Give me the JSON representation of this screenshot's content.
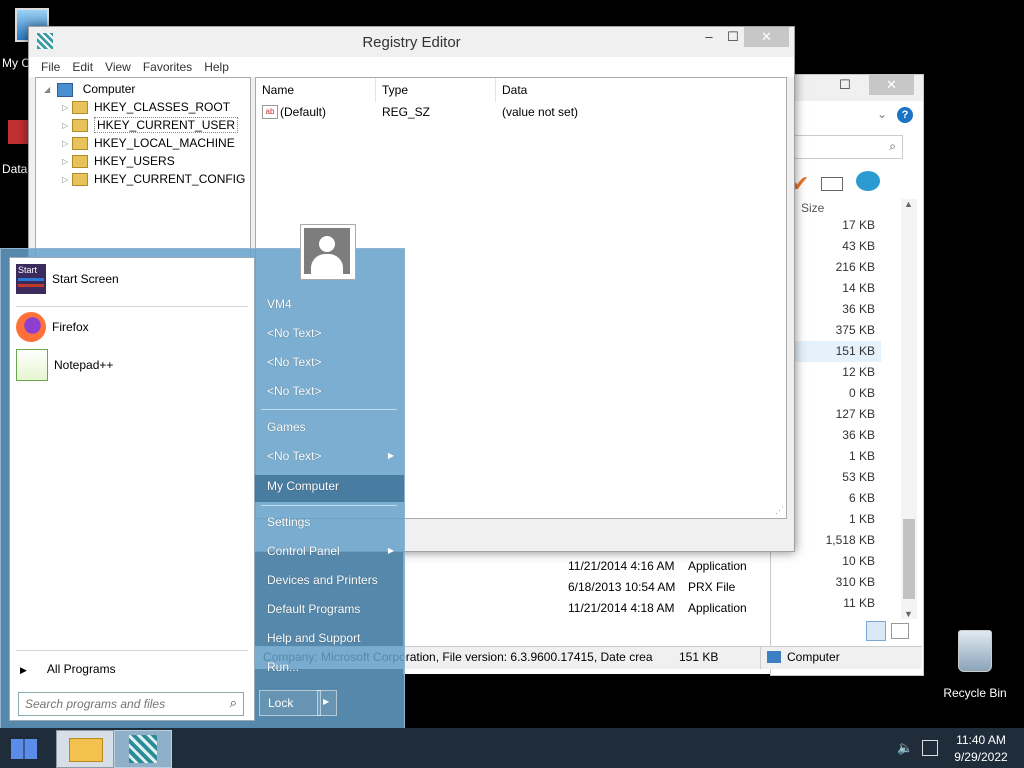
{
  "desktop": {
    "icons": [
      {
        "label": "My C",
        "icon": "computer-icon"
      },
      {
        "label": "Data",
        "icon": "shortcut-icon"
      },
      {
        "label": "Recycle Bin",
        "icon": "recycle-bin-icon"
      }
    ]
  },
  "explorer": {
    "min": "–",
    "max": "☐",
    "close": "✕",
    "size_header": "Size",
    "sizes": [
      "17 KB",
      "43 KB",
      "216 KB",
      "14 KB",
      "36 KB",
      "375 KB",
      "151 KB",
      "12 KB",
      "0 KB",
      "127 KB",
      "36 KB",
      "1 KB",
      "53 KB",
      "6 KB",
      "1 KB",
      "1,518 KB",
      "10 KB",
      "310 KB",
      "11 KB"
    ],
    "rows": [
      {
        "date": "11/21/2014 4:16 AM",
        "type": "Application"
      },
      {
        "date": "6/18/2013 10:54 AM",
        "type": "PRX File"
      },
      {
        "date": "11/21/2014 4:18 AM",
        "type": "Application"
      }
    ],
    "status_text": "Company: Microsoft Corporation, File version: 6.3.9600.17415, Date crea",
    "status_size": "151 KB",
    "status_location": "Computer"
  },
  "regedit": {
    "title": "Registry Editor",
    "min": "–",
    "max": "☐",
    "close": "✕",
    "menu": [
      "File",
      "Edit",
      "View",
      "Favorites",
      "Help"
    ],
    "tree": {
      "root": "Computer",
      "children": [
        "HKEY_CLASSES_ROOT",
        "HKEY_CURRENT_USER",
        "HKEY_LOCAL_MACHINE",
        "HKEY_USERS",
        "HKEY_CURRENT_CONFIG"
      ]
    },
    "columns": [
      "Name",
      "Type",
      "Data"
    ],
    "values": [
      {
        "name": "(Default)",
        "type": "REG_SZ",
        "data": "(value not set)"
      }
    ]
  },
  "start_menu": {
    "programs": [
      {
        "label": "Start Screen",
        "icon": "start-screen-icon",
        "badge": "Start"
      },
      {
        "label": "Firefox",
        "icon": "firefox-icon"
      },
      {
        "label": "Notepad++",
        "icon": "notepadpp-icon"
      }
    ],
    "all_programs": "All Programs",
    "search_placeholder": "Search programs and files",
    "right": {
      "user": "VM4",
      "no_text": "<No Text>",
      "games": "Games",
      "my_computer": "My Computer",
      "settings": "Settings",
      "control_panel": "Control Panel",
      "devices": "Devices and Printers",
      "default_programs": "Default Programs",
      "help": "Help and Support",
      "run": "Run..."
    },
    "lock": "Lock"
  },
  "taskbar": {
    "time": "11:40 AM",
    "date": "9/29/2022"
  },
  "colors": {
    "taskbar": "#1f2c3a",
    "start_menu": "#64a0c8"
  }
}
